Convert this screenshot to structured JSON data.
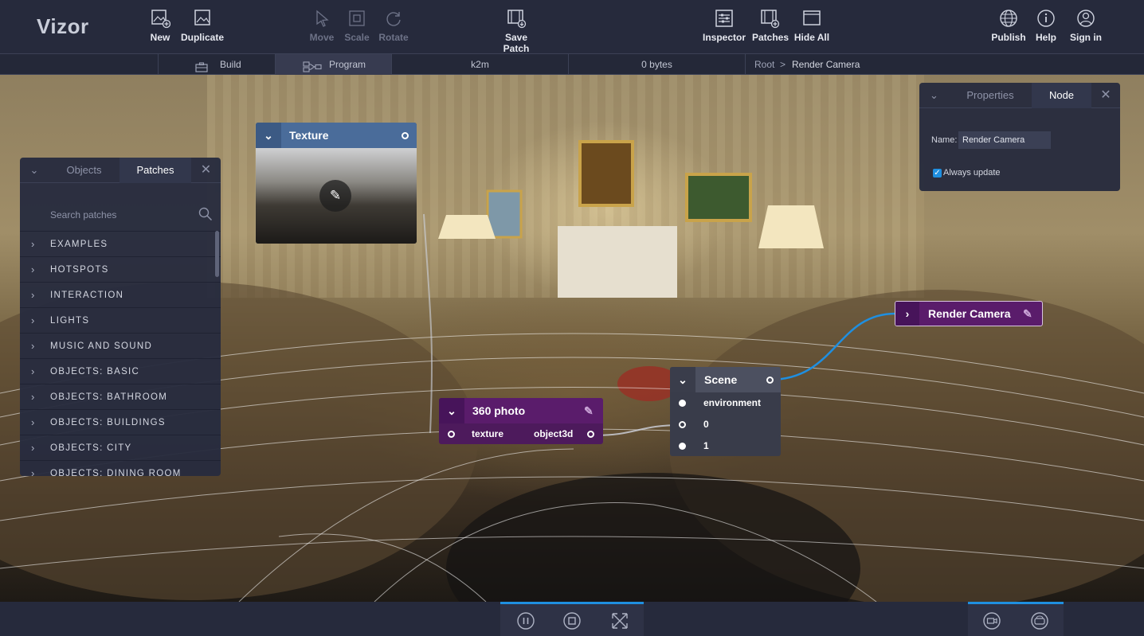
{
  "app": {
    "logo": "Vizor"
  },
  "toolbar": {
    "new": "New",
    "duplicate": "Duplicate",
    "move": "Move",
    "scale": "Scale",
    "rotate": "Rotate",
    "save_patch": "Save Patch",
    "inspector": "Inspector",
    "patches": "Patches",
    "hide_all": "Hide All",
    "publish": "Publish",
    "help": "Help",
    "sign_in": "Sign in"
  },
  "subbar": {
    "build": "Build",
    "program": "Program",
    "project": "k2m",
    "size": "0 bytes",
    "breadcrumb_root": "Root",
    "breadcrumb_sep": ">",
    "breadcrumb_current": "Render Camera"
  },
  "patches_panel": {
    "tab_objects": "Objects",
    "tab_patches": "Patches",
    "search_placeholder": "Search patches",
    "categories": [
      "EXAMPLES",
      "HOTSPOTS",
      "INTERACTION",
      "LIGHTS",
      "MUSIC AND SOUND",
      "OBJECTS: BASIC",
      "OBJECTS: BATHROOM",
      "OBJECTS: BUILDINGS",
      "OBJECTS: CITY",
      "OBJECTS: DINING ROOM"
    ]
  },
  "nodes": {
    "texture": {
      "title": "Texture"
    },
    "photo360": {
      "title": "360 photo",
      "in": "texture",
      "out": "object3d"
    },
    "scene": {
      "title": "Scene",
      "ports": [
        "environment",
        "0",
        "1"
      ]
    },
    "render_camera": {
      "title": "Render Camera"
    }
  },
  "properties_panel": {
    "tab_properties": "Properties",
    "tab_node": "Node",
    "name_label": "Name:",
    "name_value": "Render Camera",
    "always_update": "Always update"
  },
  "colors": {
    "accent": "#1f8fe0",
    "purple_node": "#5a1c6b",
    "texture_node": "#4a6c9a",
    "scene_node": "#4c5060"
  },
  "icons": [
    "pause-icon",
    "stop-icon",
    "fullscreen-icon",
    "camera-icon",
    "vr-icon"
  ]
}
